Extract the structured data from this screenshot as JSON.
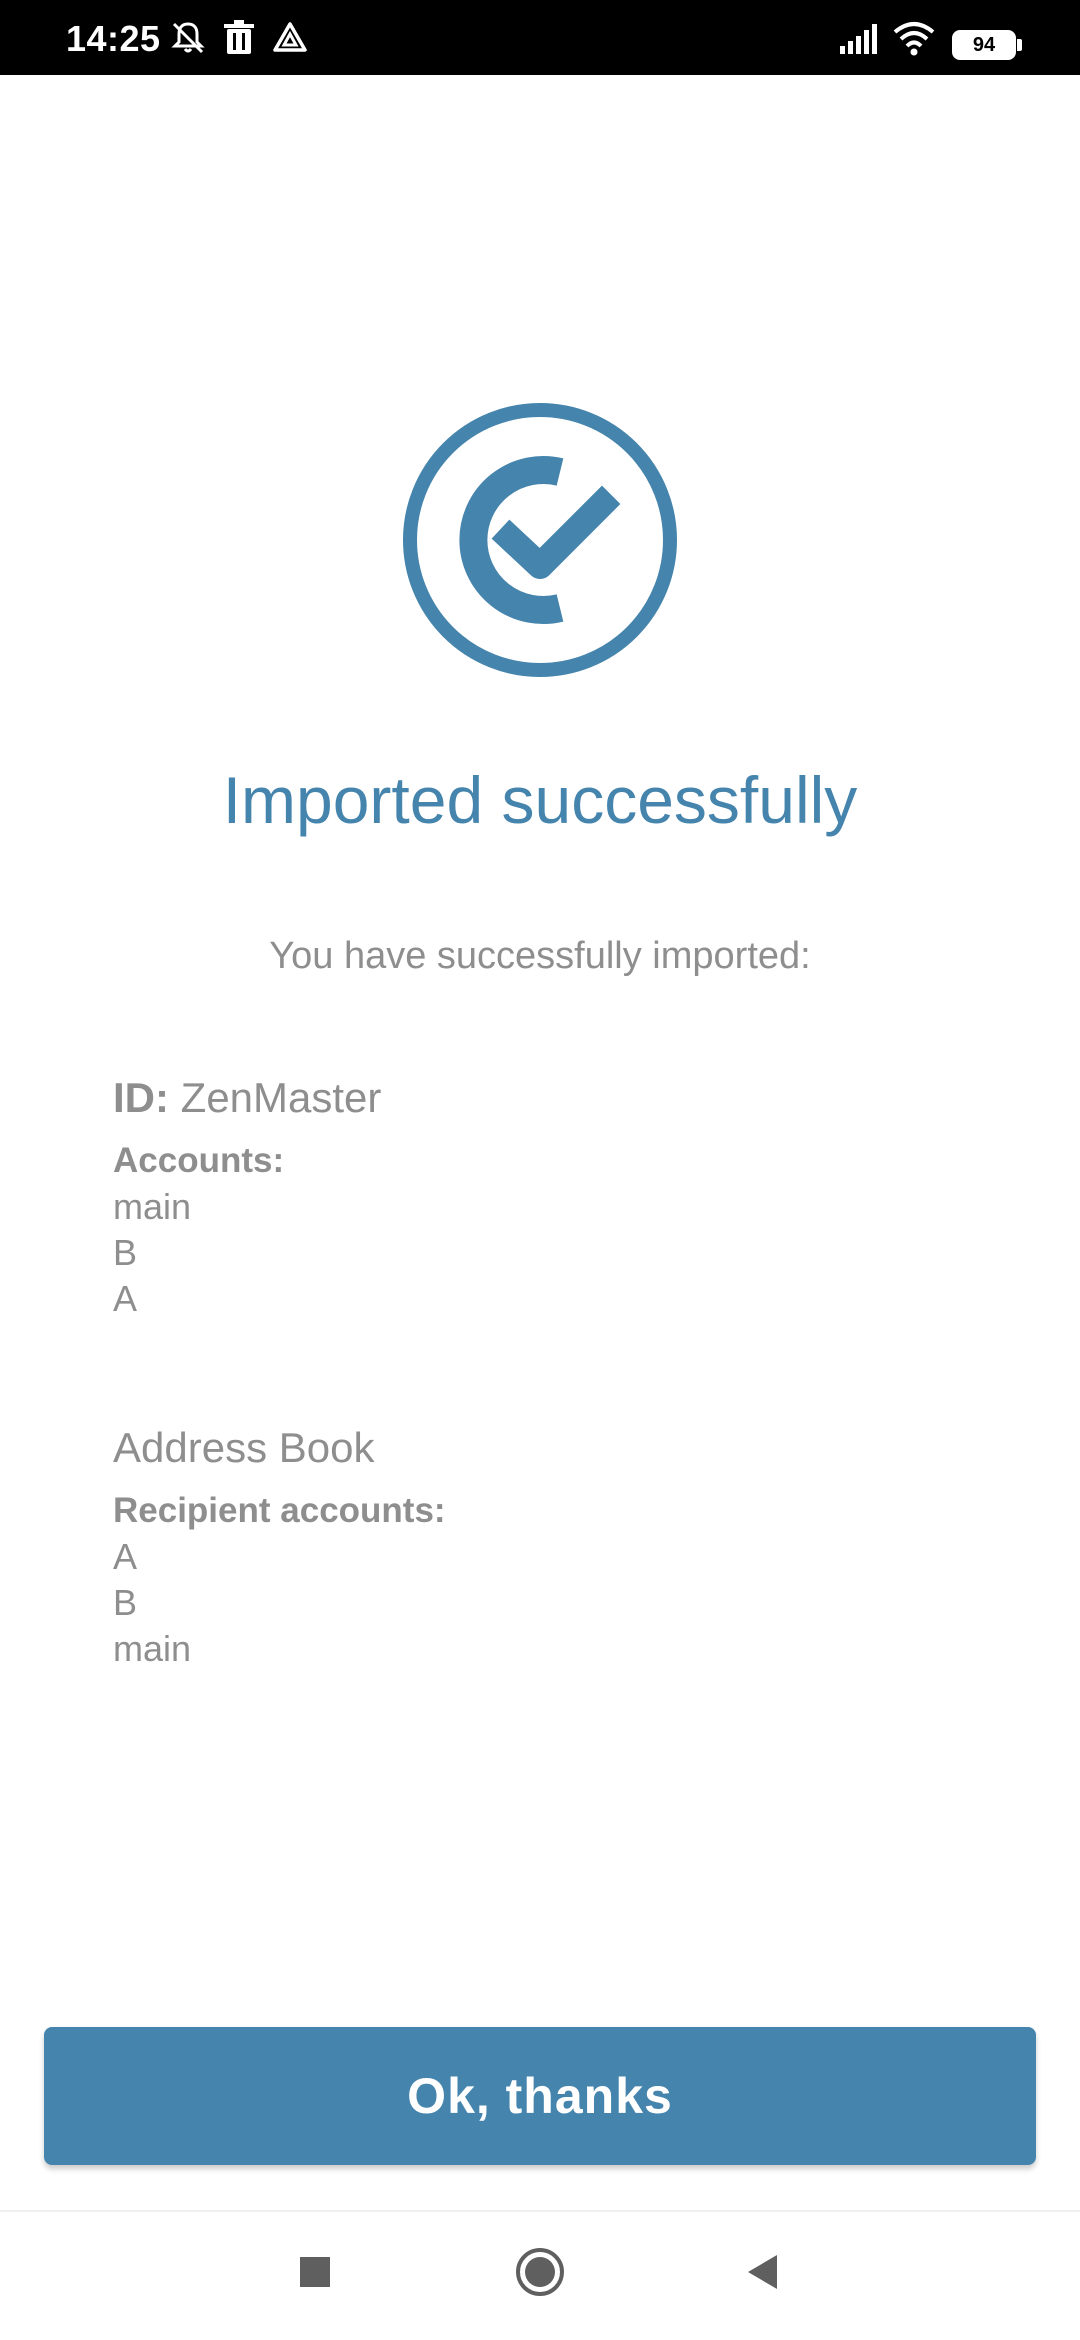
{
  "status_bar": {
    "time": "14:25",
    "icons": [
      "mute-icon",
      "trash-icon",
      "drive-icon",
      "signal-icon",
      "wifi-icon"
    ],
    "battery": "94"
  },
  "main": {
    "icon": "success-check-icon",
    "title": "Imported successfully",
    "subtitle": "You have successfully imported:",
    "id_label": "ID:",
    "id_value": "ZenMaster",
    "accounts_label": "Accounts:",
    "accounts": [
      "main",
      "B",
      "A"
    ],
    "address_book_title": "Address Book",
    "recipient_label": "Recipient accounts:",
    "recipients": [
      "A",
      "B",
      "main"
    ]
  },
  "footer": {
    "ok_label": "Ok, thanks"
  },
  "nav": {
    "icons": [
      "recents-square-icon",
      "home-circle-icon",
      "back-triangle-icon"
    ]
  },
  "colors": {
    "accent": "#4584ad",
    "muted_text": "#8e8e8e"
  }
}
